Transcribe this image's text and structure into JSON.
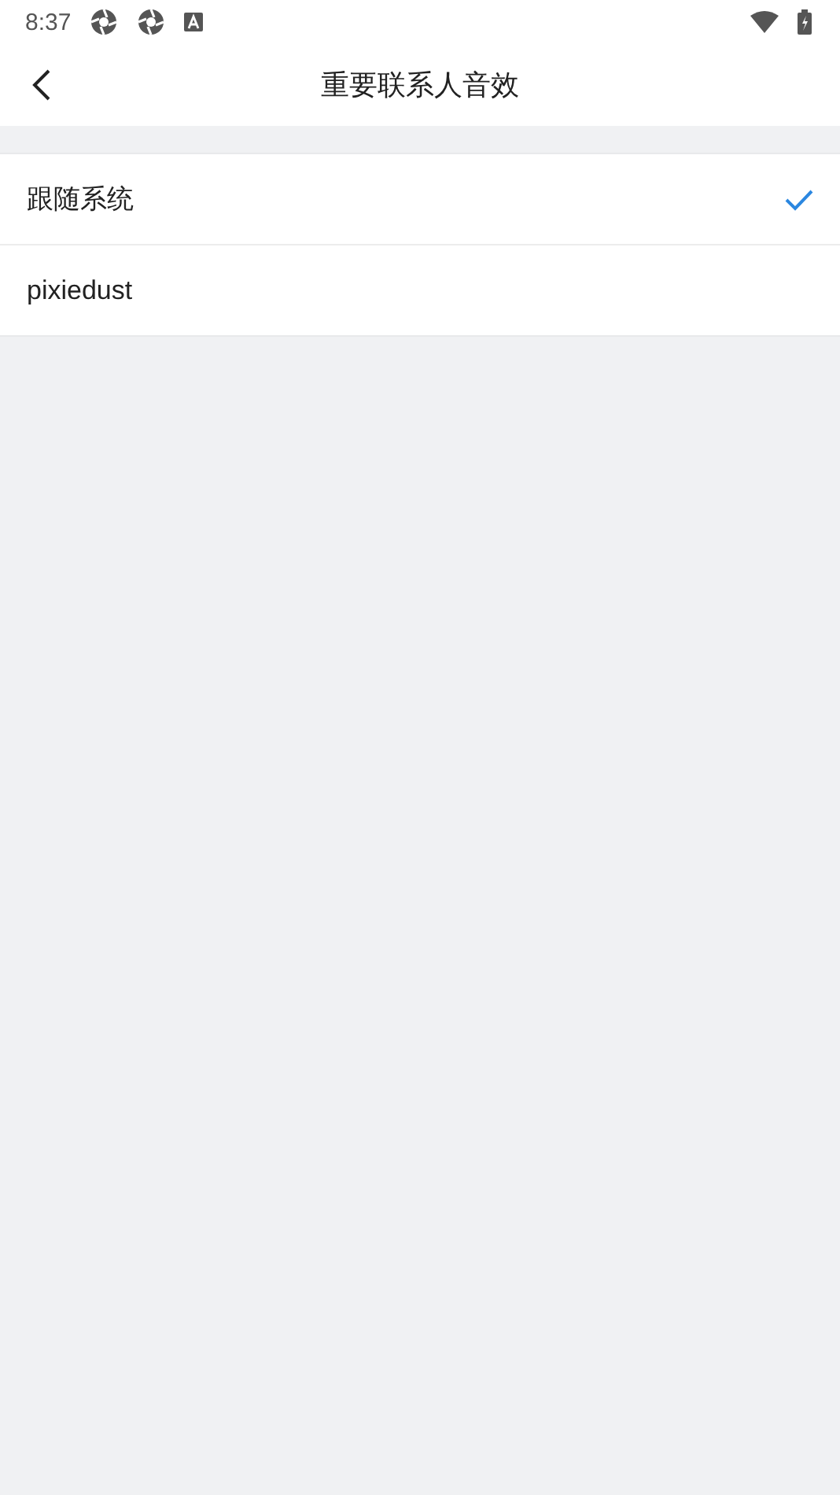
{
  "status_bar": {
    "time": "8:37"
  },
  "header": {
    "title": "重要联系人音效"
  },
  "options": [
    {
      "label": "跟随系统",
      "selected": true
    },
    {
      "label": "pixiedust",
      "selected": false
    }
  ]
}
